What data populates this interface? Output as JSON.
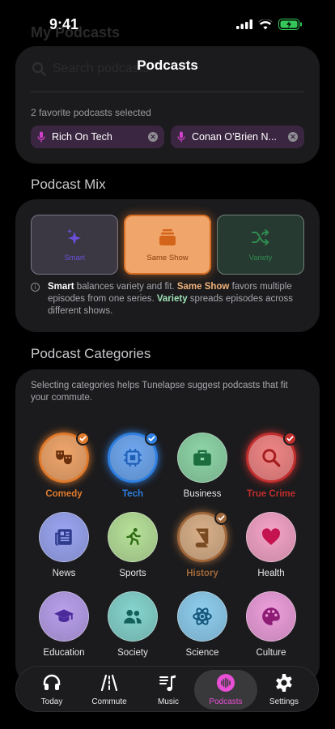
{
  "status": {
    "time": "9:41"
  },
  "background": {
    "title": "My Podcasts",
    "search_placeholder": "Search podcasts"
  },
  "header": {
    "title": "Podcasts"
  },
  "selection": {
    "count_text": "2 favorite podcasts selected",
    "chips": [
      {
        "label": "Rich On Tech",
        "icon": "microphone-icon"
      },
      {
        "label": "Conan O’Brien N...",
        "icon": "microphone-icon"
      }
    ]
  },
  "mix": {
    "heading": "Podcast Mix",
    "options": [
      {
        "label": "Smart",
        "icon": "sparkles-icon",
        "selected": false
      },
      {
        "label": "Same Show",
        "icon": "stack-icon",
        "selected": true
      },
      {
        "label": "Variety",
        "icon": "shuffle-icon",
        "selected": false
      }
    ],
    "info": {
      "smart_term": "Smart",
      "smart_text": " balances variety and fit. ",
      "same_term": "Same Show",
      "same_text": " favors multiple episodes from one series. ",
      "variety_term": "Variety",
      "variety_text": " spreads episodes across different shows."
    }
  },
  "categories": {
    "heading": "Podcast Categories",
    "description": "Selecting categories helps Tunelapse suggest podcasts that fit your commute.",
    "items": [
      {
        "label": "Comedy",
        "icon": "theater-masks-icon",
        "selected": true,
        "color": "#f0a66b"
      },
      {
        "label": "Tech",
        "icon": "chip-icon",
        "selected": true,
        "color": "#6fa8f0"
      },
      {
        "label": "Business",
        "icon": "briefcase-icon",
        "selected": false,
        "color": "#8fd6a8"
      },
      {
        "label": "True Crime",
        "icon": "magnifier-icon",
        "selected": true,
        "color": "#f08585"
      },
      {
        "label": "News",
        "icon": "newspaper-icon",
        "selected": false,
        "color": "#9aa6f2"
      },
      {
        "label": "Sports",
        "icon": "runner-icon",
        "selected": false,
        "color": "#b8e29a"
      },
      {
        "label": "History",
        "icon": "book-icon",
        "selected": true,
        "color": "#d9b089"
      },
      {
        "label": "Health",
        "icon": "heart-icon",
        "selected": false,
        "color": "#f5a4c7"
      },
      {
        "label": "Education",
        "icon": "graduation-cap-icon",
        "selected": false,
        "color": "#b9a0ec"
      },
      {
        "label": "Society",
        "icon": "people-icon",
        "selected": false,
        "color": "#86d5ce"
      },
      {
        "label": "Science",
        "icon": "atom-icon",
        "selected": false,
        "color": "#8fcff0"
      },
      {
        "label": "Culture",
        "icon": "palette-icon",
        "selected": false,
        "color": "#ee9fdc"
      }
    ]
  },
  "tabbar": {
    "tabs": [
      {
        "label": "Today",
        "icon": "headphones-icon",
        "active": false
      },
      {
        "label": "Commute",
        "icon": "road-icon",
        "active": false
      },
      {
        "label": "Music",
        "icon": "music-note-icon",
        "active": false
      },
      {
        "label": "Podcasts",
        "icon": "waveform-icon",
        "active": true
      },
      {
        "label": "Settings",
        "icon": "gear-icon",
        "active": false
      }
    ]
  }
}
